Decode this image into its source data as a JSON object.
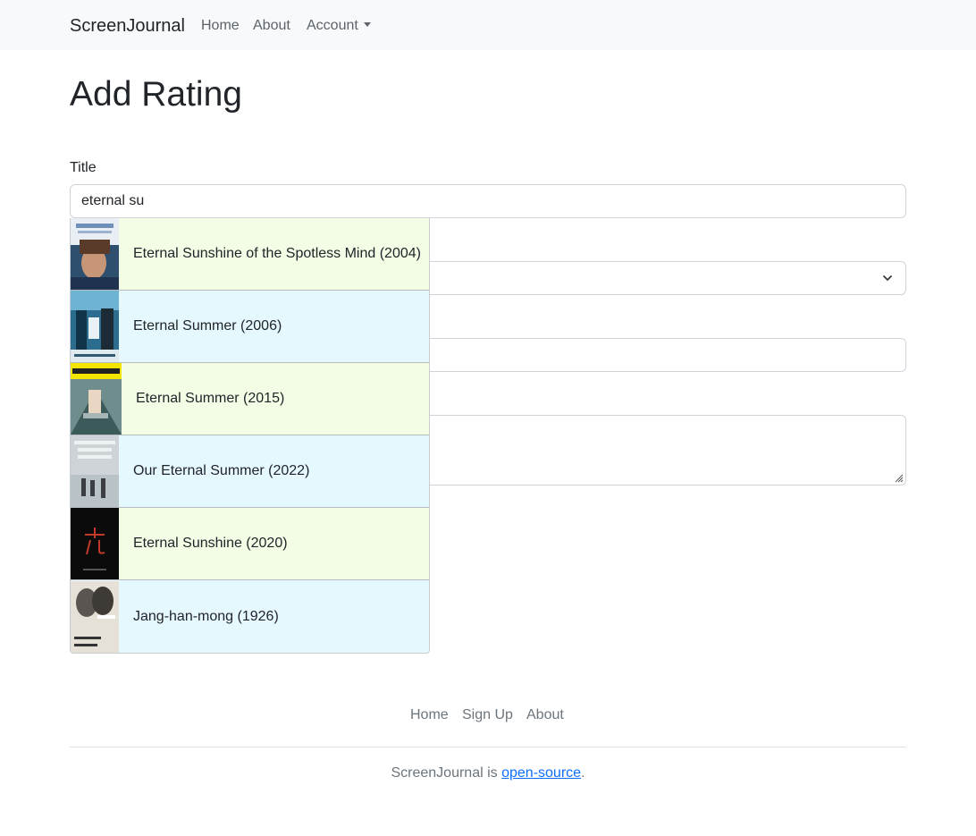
{
  "navbar": {
    "brand": "ScreenJournal",
    "links": [
      "Home",
      "About",
      "Account"
    ]
  },
  "page": {
    "title": "Add Rating"
  },
  "form": {
    "title_label": "Title",
    "title_value": "eternal su"
  },
  "autocomplete": {
    "items": [
      {
        "label": "Eternal Sunshine of the Spotless Mind (2004)",
        "poster": "eternal-sunshine-2004-poster"
      },
      {
        "label": "Eternal Summer (2006)",
        "poster": "eternal-summer-2006-poster"
      },
      {
        "label": "Eternal Summer (2015)",
        "poster": "eternal-summer-2015-poster"
      },
      {
        "label": "Our Eternal Summer (2022)",
        "poster": "our-eternal-summer-2022-poster"
      },
      {
        "label": "Eternal Sunshine (2020)",
        "poster": "eternal-sunshine-2020-poster"
      },
      {
        "label": "Jang-han-mong (1926)",
        "poster": "jang-han-mong-1926-poster"
      }
    ]
  },
  "footer": {
    "links": [
      "Home",
      "Sign Up",
      "About"
    ],
    "text_prefix": "ScreenJournal is ",
    "link_text": "open-source",
    "text_suffix": "."
  },
  "colors": {
    "row_green": "#f3fde6",
    "row_blue": "#e5f8fd",
    "link_blue": "#0d6efd",
    "navbar_bg": "#f8f9fa"
  }
}
